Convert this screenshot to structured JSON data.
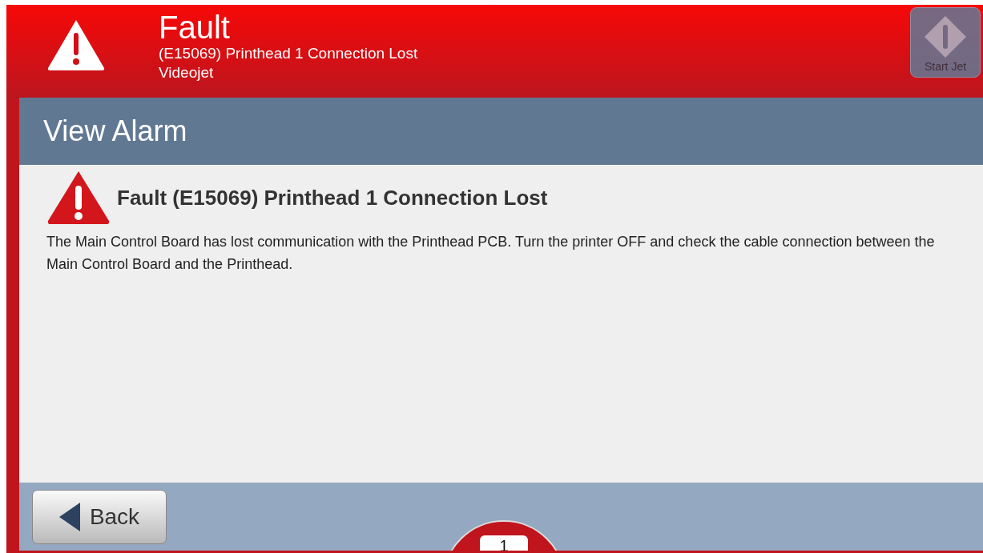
{
  "header": {
    "title": "Fault",
    "subtitle": "(E15069) Printhead 1 Connection Lost",
    "source": "Videojet",
    "start_button": {
      "label": "Start Jet",
      "disabled": true
    }
  },
  "page_title": "View Alarm",
  "alarm": {
    "heading": "Fault (E15069) Printhead 1 Connection Lost",
    "description": "The Main Control Board has lost communication with the Printhead PCB. Turn the printer OFF and check the cable connection between the Main Control Board and the Printhead."
  },
  "footer": {
    "back_label": "Back",
    "page_indicator": "1"
  }
}
